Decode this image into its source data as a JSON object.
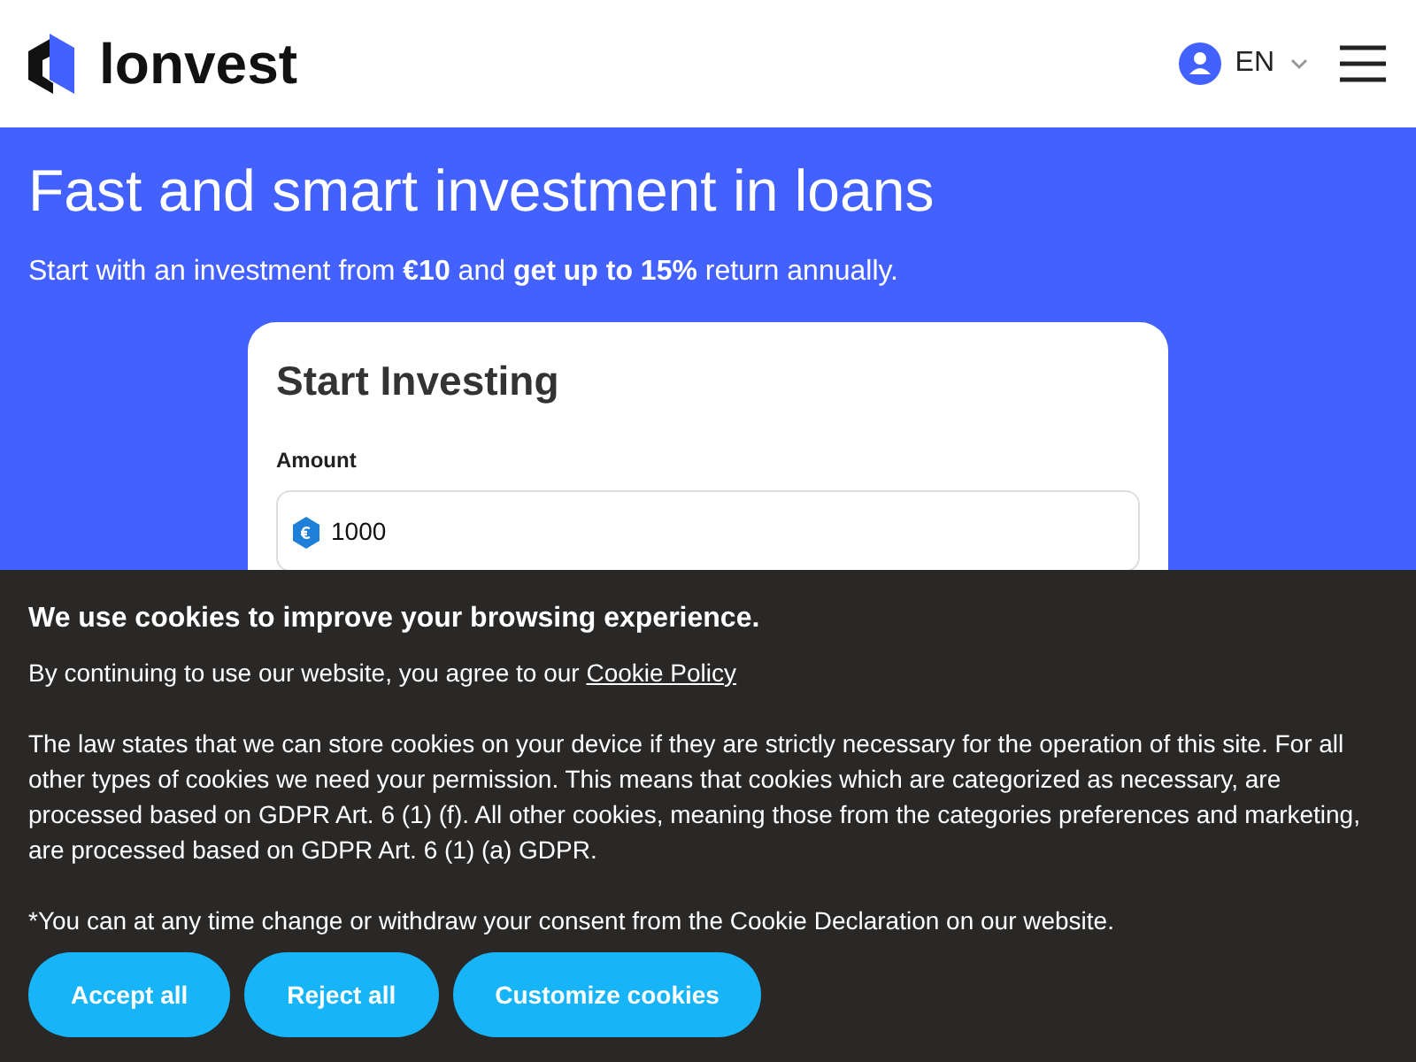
{
  "header": {
    "logo_text": "lonvest",
    "language": "EN"
  },
  "hero": {
    "title": "Fast and smart investment in loans",
    "subtitle": "Start with an investment from **€10** and **get up to 15%** return annually."
  },
  "card": {
    "title": "Start Investing",
    "amount_label": "Amount",
    "amount_value": "1000"
  },
  "cookie_banner": {
    "title": "We use cookies to improve your browsing experience.",
    "intro": "By continuing to use our website, you agree to our ",
    "link": "Cookie Policy",
    "paragraphs": [
      "The law states that we can store cookies on your device if they are strictly necessary for the operation of this site. For all other types of cookies we need your permission. This means that cookies which are categorized as necessary, are processed based on GDPR Art. 6 (1) (f). All other cookies, meaning those from the categories preferences and marketing, are processed based on GDPR Art. 6 (1) (a) GDPR.",
      "*You can at any time change or withdraw your consent from the Cookie Declaration on our website."
    ],
    "buttons": [
      "Accept all",
      "Reject all",
      "Customize cookies"
    ]
  }
}
